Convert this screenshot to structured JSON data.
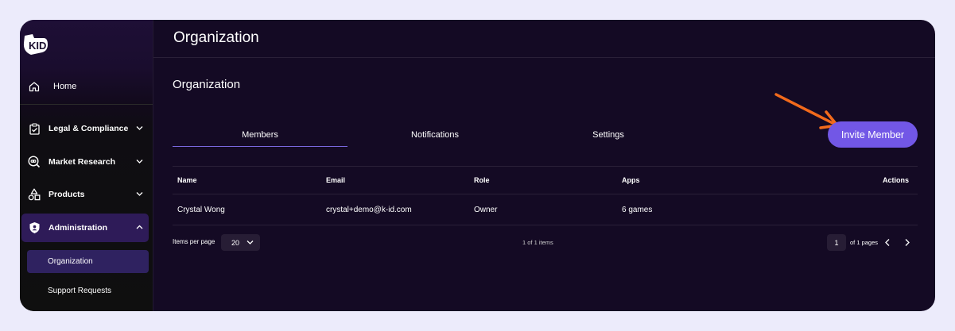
{
  "sidebar": {
    "home_label": "Home",
    "items": [
      {
        "label": "Legal & Compliance"
      },
      {
        "label": "Market Research"
      },
      {
        "label": "Products"
      },
      {
        "label": "Administration"
      }
    ],
    "sub_items": [
      {
        "label": "Organization",
        "active": true
      },
      {
        "label": "Support Requests",
        "active": false
      }
    ]
  },
  "header": {
    "title": "Organization"
  },
  "main": {
    "section_title": "Organization",
    "tabs": [
      {
        "label": "Members",
        "active": true
      },
      {
        "label": "Notifications",
        "active": false
      },
      {
        "label": "Settings",
        "active": false
      }
    ],
    "invite_label": "Invite Member",
    "table": {
      "columns": [
        "Name",
        "Email",
        "Role",
        "Apps",
        "Actions"
      ],
      "rows": [
        [
          "Crystal Wong",
          "crystal+demo@k-id.com",
          "Owner",
          "6 games",
          ""
        ]
      ]
    },
    "pagination": {
      "items_per_page_label": "Items per page",
      "items_per_page_value": "20",
      "range_text": "1 of 1 items",
      "current_page": "1",
      "pages_text": "of 1 pages"
    }
  },
  "colors": {
    "accent": "#7257e6",
    "annotation_arrow": "#f26a1b",
    "background": "#140a24",
    "outer": "#ecebfb"
  }
}
